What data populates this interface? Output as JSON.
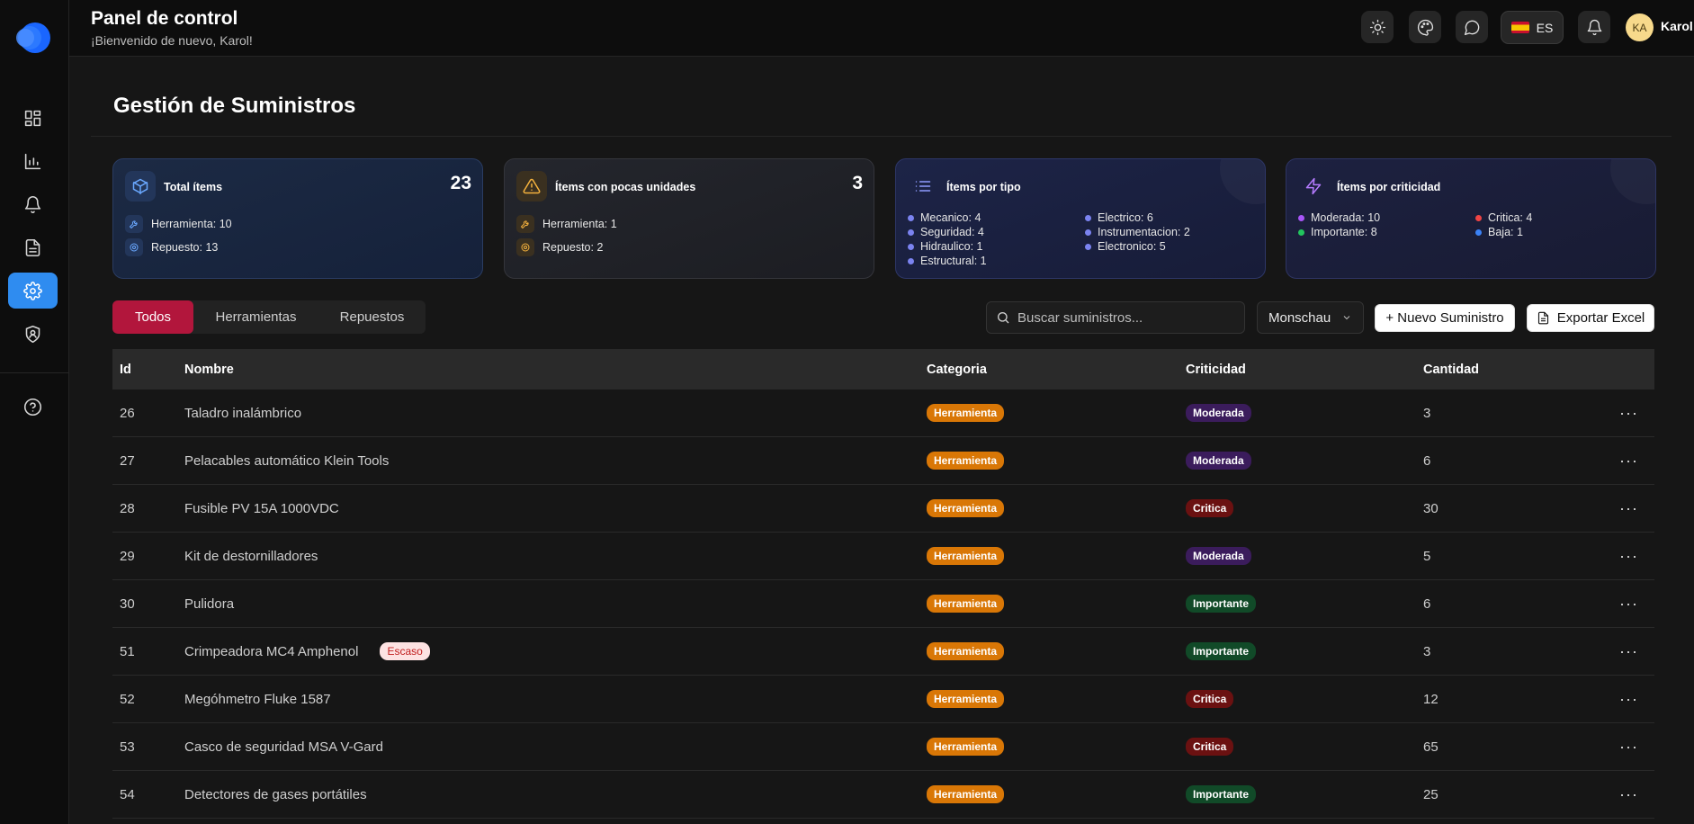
{
  "header": {
    "title": "Panel de control",
    "subtitle": "¡Bienvenido de nuevo, Karol!",
    "language": "ES",
    "avatar_initials": "KA",
    "username": "Karol"
  },
  "sidebar": {
    "items": [
      {
        "icon": "dashboard-grid-icon",
        "active": false
      },
      {
        "icon": "bar-chart-icon",
        "active": false
      },
      {
        "icon": "bell-icon",
        "active": false
      },
      {
        "icon": "document-icon",
        "active": false
      },
      {
        "icon": "gear-icon",
        "active": true
      },
      {
        "icon": "shield-user-icon",
        "active": false
      }
    ],
    "help_icon": "help-circle-icon"
  },
  "page": {
    "title": "Gestión de Suministros"
  },
  "cards": {
    "total": {
      "title": "Total ítems",
      "count": "23",
      "lines": [
        "Herramienta: 10",
        "Repuesto: 13"
      ]
    },
    "low": {
      "title": "Ítems con pocas unidades",
      "count": "3",
      "lines": [
        "Herramienta: 1",
        "Repuesto: 2"
      ]
    },
    "types": {
      "title": "Ítems por tipo",
      "left": [
        "Mecanico: 4",
        "Seguridad: 4",
        "Hidraulico: 1",
        "Estructural: 1"
      ],
      "right": [
        "Electrico: 6",
        "Instrumentacion: 2",
        "Electronico: 5"
      ]
    },
    "criticality": {
      "title": "Ítems por criticidad",
      "left": [
        "Moderada: 10",
        "Importante: 8"
      ],
      "right": [
        "Critica: 4",
        "Baja: 1"
      ],
      "colors": {
        "Moderada": "#a855f7",
        "Importante": "#22c55e",
        "Critica": "#ef4444",
        "Baja": "#3b82f6"
      }
    }
  },
  "tabs": [
    "Todos",
    "Herramientas",
    "Repuestos"
  ],
  "toolbar": {
    "search_placeholder": "Buscar suministros...",
    "location": "Monschau",
    "new_label": "+ Nuevo Suministro",
    "export_label": "Exportar Excel"
  },
  "table": {
    "columns": [
      "Id",
      "Nombre",
      "Categoria",
      "Criticidad",
      "Cantidad"
    ],
    "rows": [
      {
        "id": "26",
        "name": "Taladro inalámbrico",
        "category": "Herramienta",
        "criticality": "Moderada",
        "qty": "3",
        "tag": ""
      },
      {
        "id": "27",
        "name": "Pelacables automático Klein Tools",
        "category": "Herramienta",
        "criticality": "Moderada",
        "qty": "6",
        "tag": ""
      },
      {
        "id": "28",
        "name": "Fusible PV 15A 1000VDC",
        "category": "Herramienta",
        "criticality": "Critica",
        "qty": "30",
        "tag": ""
      },
      {
        "id": "29",
        "name": "Kit de destornilladores",
        "category": "Herramienta",
        "criticality": "Moderada",
        "qty": "5",
        "tag": ""
      },
      {
        "id": "30",
        "name": "Pulidora",
        "category": "Herramienta",
        "criticality": "Importante",
        "qty": "6",
        "tag": ""
      },
      {
        "id": "51",
        "name": "Crimpeadora MC4 Amphenol",
        "category": "Herramienta",
        "criticality": "Importante",
        "qty": "3",
        "tag": "Escaso"
      },
      {
        "id": "52",
        "name": "Megóhmetro Fluke 1587",
        "category": "Herramienta",
        "criticality": "Critica",
        "qty": "12",
        "tag": ""
      },
      {
        "id": "53",
        "name": "Casco de seguridad MSA V-Gard",
        "category": "Herramienta",
        "criticality": "Critica",
        "qty": "65",
        "tag": ""
      },
      {
        "id": "54",
        "name": "Detectores de gases portátiles",
        "category": "Herramienta",
        "criticality": "Importante",
        "qty": "25",
        "tag": ""
      }
    ],
    "row_action": "···"
  }
}
